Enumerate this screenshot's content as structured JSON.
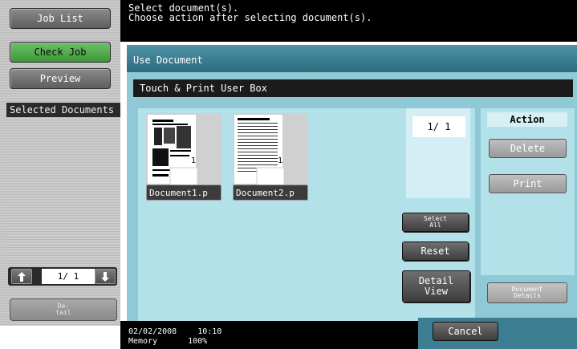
{
  "sidebar": {
    "job_list": "Job List",
    "check_job": "Check Job",
    "preview": "Preview",
    "selected_documents": "Selected Documents",
    "pager": "1/  1",
    "detail_line1": "De-",
    "detail_line2": "tail"
  },
  "message": {
    "line1": "Select document(s).",
    "line2": "Choose action after selecting document(s)."
  },
  "panel": {
    "title": "Use Document",
    "box_title": "Touch & Print User Box",
    "page_indicator": "1/  1",
    "documents": [
      {
        "name": "Document1.p",
        "page": "1"
      },
      {
        "name": "Document2.p",
        "page": "1"
      }
    ],
    "select_all_line1": "Select",
    "select_all_line2": "All",
    "reset": "Reset",
    "detail_view_line1": "Detail",
    "detail_view_line2": "View"
  },
  "actions": {
    "title": "Action",
    "delete": "Delete",
    "print": "Print",
    "document_details_line1": "Document",
    "document_details_line2": "Details"
  },
  "status": {
    "date": "02/02/2008",
    "time": "10:10",
    "memory_label": "Memory",
    "memory_value": "100%"
  },
  "cancel": "Cancel",
  "icons": {
    "up": "up-arrow-icon",
    "down": "down-arrow-icon"
  },
  "colors": {
    "panel": "#3d7e92",
    "panel_body": "#8fc9d5",
    "active_green": "#3b9a37"
  }
}
